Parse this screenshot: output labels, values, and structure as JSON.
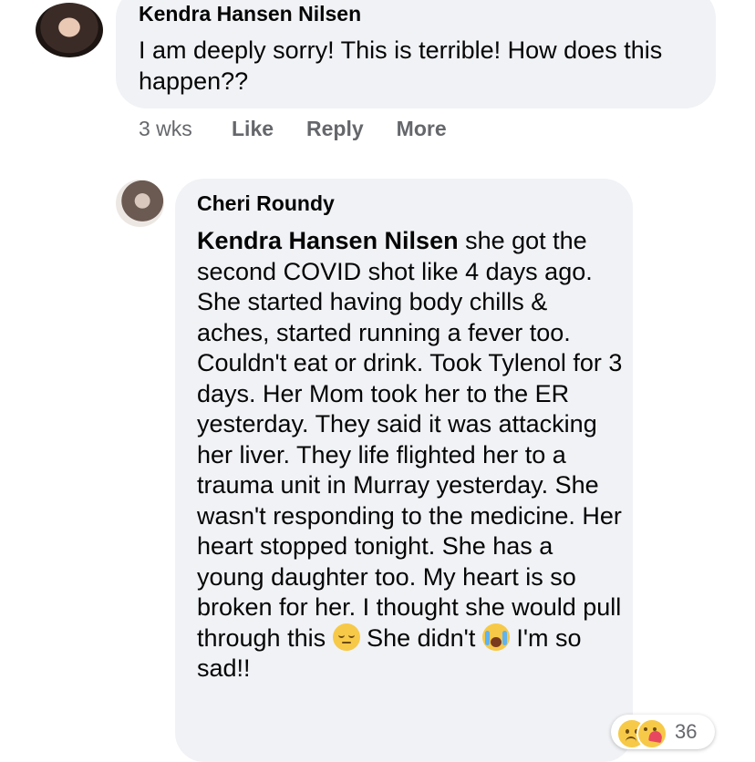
{
  "comment1": {
    "author": "Kendra Hansen Nilsen",
    "text": "I am deeply sorry! This is terrible! How does this happen??",
    "time": "3 wks",
    "actions": {
      "like": "Like",
      "reply": "Reply",
      "more": "More"
    }
  },
  "reply": {
    "author": "Cheri Roundy",
    "mention": "Kendra Hansen Nilsen",
    "text_part1": " she got the second COVID shot like 4 days ago. She started having body chills & aches, started running a fever too. Couldn't eat or drink. Took Tylenol for 3 days. Her Mom took her to the ER yesterday. They said it was attacking her liver. They life flighted her to a trauma unit in Murray yesterday. She wasn't responding to the medicine. Her heart stopped tonight. She has a young daughter too. My heart is so broken for her. I thought she would pull through this ",
    "emoji1": "pensive-face-icon",
    "text_part2": " She didn't ",
    "emoji2": "loudly-crying-face-icon",
    "text_part3": " I'm so sad!!",
    "reaction_count": "36",
    "reaction_icons": [
      "sad-reaction-icon",
      "care-reaction-icon"
    ]
  },
  "colors": {
    "bubble": "#f0f2f5",
    "secondary_text": "#65676b",
    "text": "#050505"
  }
}
